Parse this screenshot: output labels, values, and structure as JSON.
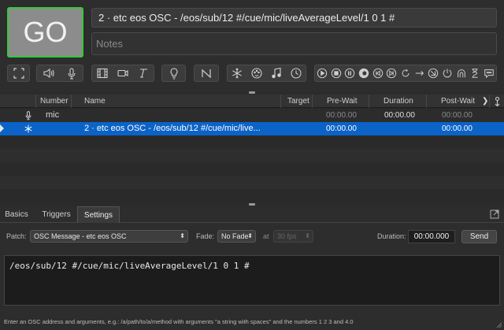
{
  "top": {
    "go_label": "GO",
    "cue_title": "2 · etc eos OSC - /eos/sub/12 #/cue/mic/liveAverageLevel/1 0 1 #",
    "notes_placeholder": "Notes"
  },
  "toolbar": {
    "groups": [
      [
        "fullscreen-icon"
      ],
      [
        "speaker-icon",
        "microphone-icon"
      ],
      [
        "film-icon",
        "camera-icon",
        "text-icon"
      ],
      [
        "lightbulb-icon"
      ],
      [
        "fade-icon"
      ],
      [
        "network-icon",
        "midi-icon",
        "music-note-icon",
        "clock-icon"
      ],
      [
        "start-icon",
        "stop-icon",
        "pause-icon",
        "load-icon",
        "reset-icon",
        "devamp-icon",
        "goto-icon",
        "target-icon",
        "arm-icon",
        "disarm-icon",
        "wait-icon",
        "memo-icon",
        "script-icon"
      ]
    ]
  },
  "list": {
    "headers": {
      "number": "Number",
      "name": "Name",
      "target": "Target",
      "prewait": "Pre-Wait",
      "duration": "Duration",
      "postwait": "Post-Wait"
    },
    "rows": [
      {
        "icon": "microphone-icon",
        "number": "mic",
        "name": "",
        "target": "",
        "prewait": "00:00.00",
        "duration": "00:00.00",
        "postwait": "00:00.00"
      },
      {
        "icon": "network-icon",
        "number": "",
        "name": "2 · etc eos OSC - /eos/sub/12 #/cue/mic/live...",
        "target": "",
        "prewait": "00:00.00",
        "duration": "",
        "postwait": "00:00.00"
      }
    ]
  },
  "inspector": {
    "tabs": [
      "Basics",
      "Triggers",
      "Settings"
    ],
    "active_tab": "Settings",
    "patch_label": "Patch:",
    "patch_value": "OSC Message - etc eos OSC",
    "fade_label": "Fade:",
    "fade_value": "No Fade",
    "at_label": "at",
    "fps_value": "30 fps",
    "duration_label": "Duration:",
    "duration_value": "00:00.000",
    "send_label": "Send",
    "osc_text": "/eos/sub/12 #/cue/mic/liveAverageLevel/1 0 1 #",
    "hint": "Enter an OSC address and arguments, e.g.: /a/path/to/a/method with arguments \"a string with spaces\" and the numbers 1 2 3 and 4.0"
  },
  "colors": {
    "go_border": "#36c93a",
    "selection": "#0b63c7"
  }
}
